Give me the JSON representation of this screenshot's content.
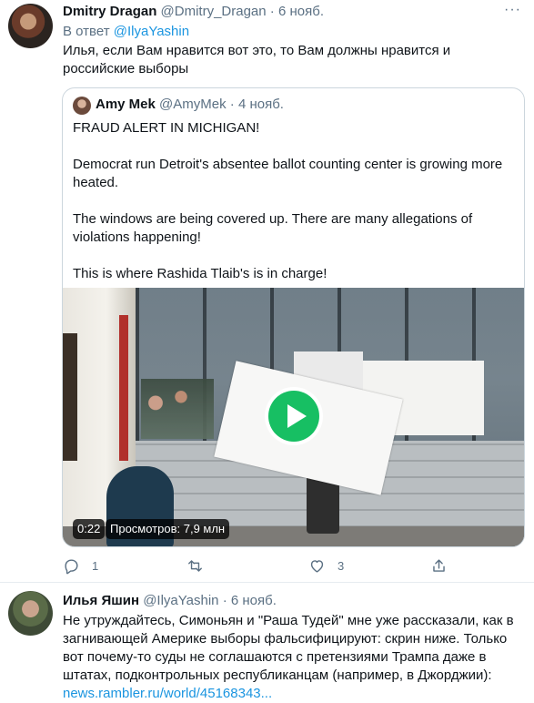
{
  "tweet1": {
    "author_name": "Dmitry Dragan",
    "author_handle": "@Dmitry_Dragan",
    "separator": "·",
    "date": "6 нояб.",
    "more_icon": "more-icon",
    "reply_prefix": "В ответ",
    "reply_handle": "@IlyaYashin",
    "text": "Илья, если Вам нравится вот это, то Вам должны нравится и российские выборы",
    "quote": {
      "author_name": "Amy Mek",
      "author_handle": "@AmyMek",
      "separator": "·",
      "date": "4 нояб.",
      "paragraphs": [
        "FRAUD ALERT IN MICHIGAN!",
        "Democrat run Detroit's absentee ballot counting center is growing more heated.",
        "The windows are being covered up. There are many allegations of violations happening!",
        "This is where Rashida Tlaib's is in charge!"
      ],
      "video": {
        "duration": "0:22",
        "views": "Просмотров: 7,9 млн",
        "play_icon": "play-icon"
      }
    },
    "actions": {
      "reply_count": "1",
      "retweet_count": "",
      "like_count": "3",
      "share_count": ""
    }
  },
  "tweet2": {
    "author_name": "Илья Яшин",
    "author_handle": "@IlyaYashin",
    "separator": "·",
    "date": "6 нояб.",
    "text": "Не утруждайтесь, Симоньян и \"Раша Тудей\" мне уже рассказали, как в загнивающей Америке выборы фальсифицируют: скрин ниже. Только вот почему-то суды не соглашаются с претензиями Трампа даже в штатах, подконтрольных республиканцам (например, в Джорджии):",
    "link": "news.rambler.ru/world/45168343..."
  },
  "colors": {
    "link": "#1b95e0",
    "muted": "#5b7083",
    "text": "#0f1419",
    "play_green": "#17bf63",
    "border": "#ccd6dd"
  }
}
